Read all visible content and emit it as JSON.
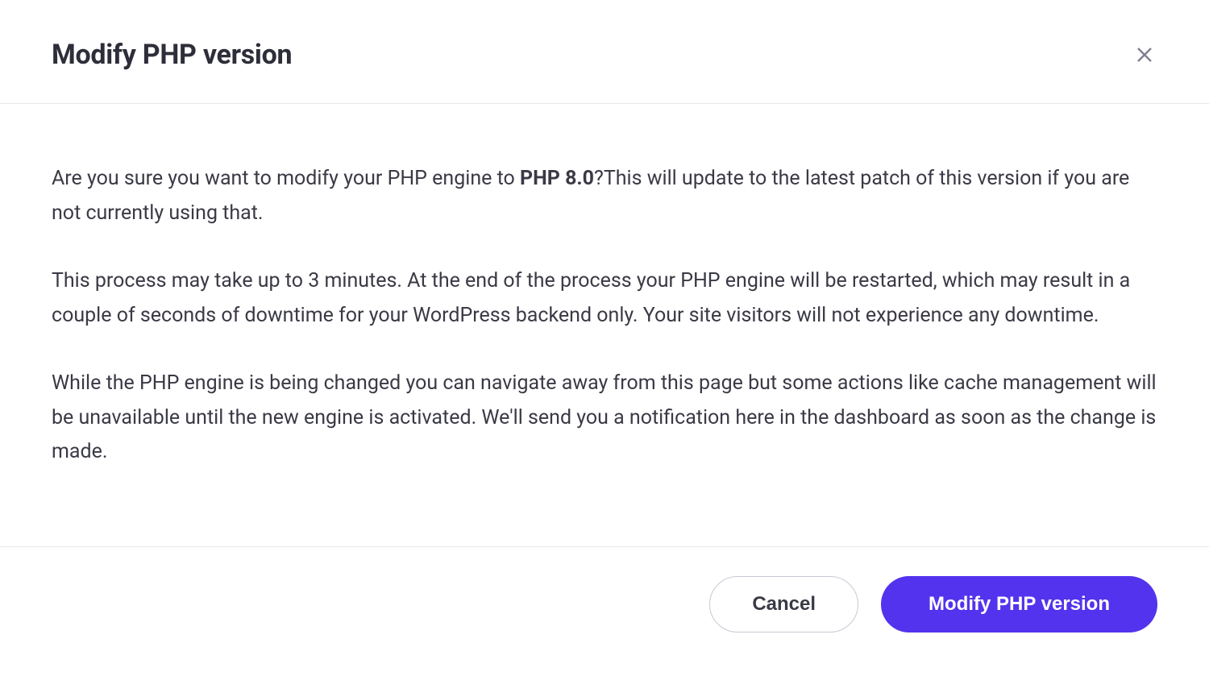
{
  "modal": {
    "title": "Modify PHP version",
    "body": {
      "p1_prefix": "Are you sure you want to modify your PHP engine to ",
      "p1_bold": "PHP 8.0",
      "p1_suffix": "?This will update to the latest patch of this version if you are not currently using that.",
      "p2": "This process may take up to 3 minutes. At the end of the process your PHP engine will be restarted, which may result in a couple of seconds of downtime for your WordPress backend only. Your site visitors will not experience any downtime.",
      "p3": "While the PHP engine is being changed you can navigate away from this page but some actions like cache management will be unavailable until the new engine is activated. We'll send you a notification here in the dashboard as soon as the change is made."
    },
    "footer": {
      "cancel_label": "Cancel",
      "confirm_label": "Modify PHP version"
    }
  }
}
